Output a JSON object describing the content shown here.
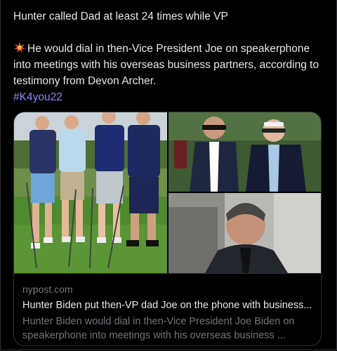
{
  "tweet": {
    "line1": "Hunter called Dad at least 24 times while VP",
    "body_icon": "collision-emoji",
    "body": "He would dial in then-Vice President Joe on speakerphone into meetings with his overseas business partners, according to testimony from Devon Archer.",
    "hashtag": "#K4you22"
  },
  "card": {
    "domain": "nypost.com",
    "headline": "Hunter Biden put then-VP dad Joe on the phone with business...",
    "description": "Hunter Biden would dial in then-Vice President Joe Biden on speakerphone into meetings with his overseas business ..."
  },
  "colors": {
    "background": "#000000",
    "text": "#e7e9ea",
    "muted": "#71767b",
    "hashtag": "#8b8dff",
    "border": "#2f3336"
  }
}
